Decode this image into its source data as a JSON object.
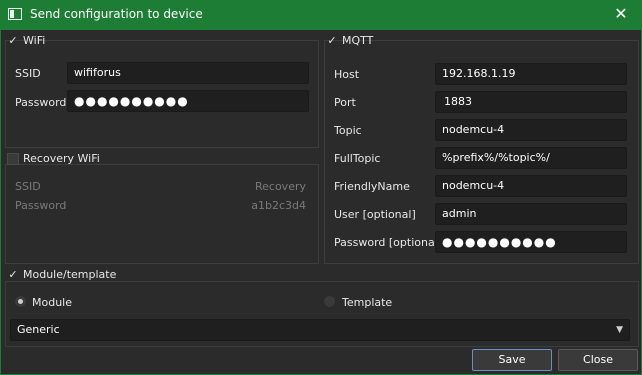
{
  "window": {
    "title": "Send configuration to device"
  },
  "wifi": {
    "header": "WiFi",
    "check": "✓",
    "ssid_label": "SSID",
    "ssid_value": "wififorus",
    "password_label": "Password",
    "password_value": "●●●●●●●●●●"
  },
  "recovery": {
    "header": "Recovery WiFi",
    "ssid_label": "SSID",
    "ssid_value": "Recovery",
    "password_label": "Password",
    "password_value": "a1b2c3d4"
  },
  "mqtt": {
    "header": "MQTT",
    "check": "✓",
    "host_label": "Host",
    "host_value": "192.168.1.19",
    "port_label": "Port",
    "port_value": "1883",
    "topic_label": "Topic",
    "topic_value": "nodemcu-4",
    "fulltopic_label": "FullTopic",
    "fulltopic_value": "%prefix%/%topic%/",
    "friendly_label": "FriendlyName",
    "friendly_value": "nodemcu-4",
    "user_label": "User [optional]",
    "user_value": "admin",
    "password_label": "Password [optional]",
    "password_value": "●●●●●●●●●●"
  },
  "module": {
    "header": "Module/template",
    "check": "✓",
    "radio_module": "Module",
    "radio_template": "Template",
    "select_value": "Generic",
    "caret": "▼"
  },
  "buttons": {
    "save": "Save",
    "close": "Close"
  },
  "icons": {
    "close": "✕"
  }
}
